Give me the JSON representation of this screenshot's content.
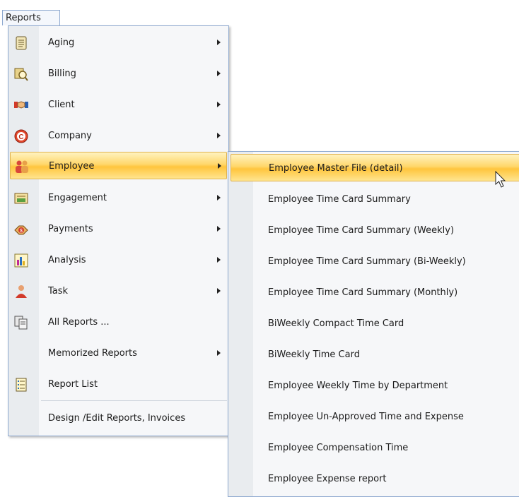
{
  "menubar": {
    "reports_label": "Reports"
  },
  "menu": {
    "items": [
      {
        "label": "Aging",
        "icon": "document-icon",
        "submenu": true
      },
      {
        "label": "Billing",
        "icon": "billing-search-icon",
        "submenu": true
      },
      {
        "label": "Client",
        "icon": "handshake-icon",
        "submenu": true
      },
      {
        "label": "Company",
        "icon": "company-c-icon",
        "submenu": true
      },
      {
        "label": "Employee",
        "icon": "employees-icon",
        "submenu": true,
        "active": true
      },
      {
        "label": "Engagement",
        "icon": "engagement-icon",
        "submenu": true
      },
      {
        "label": "Payments",
        "icon": "payments-icon",
        "submenu": true
      },
      {
        "label": "Analysis",
        "icon": "bar-chart-icon",
        "submenu": true
      },
      {
        "label": "Task",
        "icon": "task-person-icon",
        "submenu": true
      },
      {
        "label": "All Reports ...",
        "icon": "documents-icon",
        "submenu": false
      },
      {
        "label": "Memorized Reports",
        "icon": "",
        "submenu": true
      },
      {
        "label": "Report List",
        "icon": "list-icon",
        "submenu": false
      },
      {
        "label": "Design /Edit Reports, Invoices",
        "icon": "",
        "submenu": false
      }
    ]
  },
  "submenu": {
    "items": [
      {
        "label": "Employee Master File (detail)",
        "active": true
      },
      {
        "label": "Employee Time Card Summary"
      },
      {
        "label": "Employee Time Card Summary (Weekly)"
      },
      {
        "label": "Employee Time Card Summary (Bi-Weekly)"
      },
      {
        "label": "Employee Time Card Summary (Monthly)"
      },
      {
        "label": "BiWeekly Compact Time Card"
      },
      {
        "label": "BiWeekly Time Card"
      },
      {
        "label": "Employee Weekly Time by Department"
      },
      {
        "label": "Employee Un-Approved Time and Expense"
      },
      {
        "label": "Employee Compensation Time"
      },
      {
        "label": "Employee Expense report"
      }
    ]
  },
  "colors": {
    "highlight": "#ffd76b",
    "border": "#8ea9cf",
    "menu_bg": "#f6f7f9",
    "gutter_bg": "#e9ecef"
  }
}
